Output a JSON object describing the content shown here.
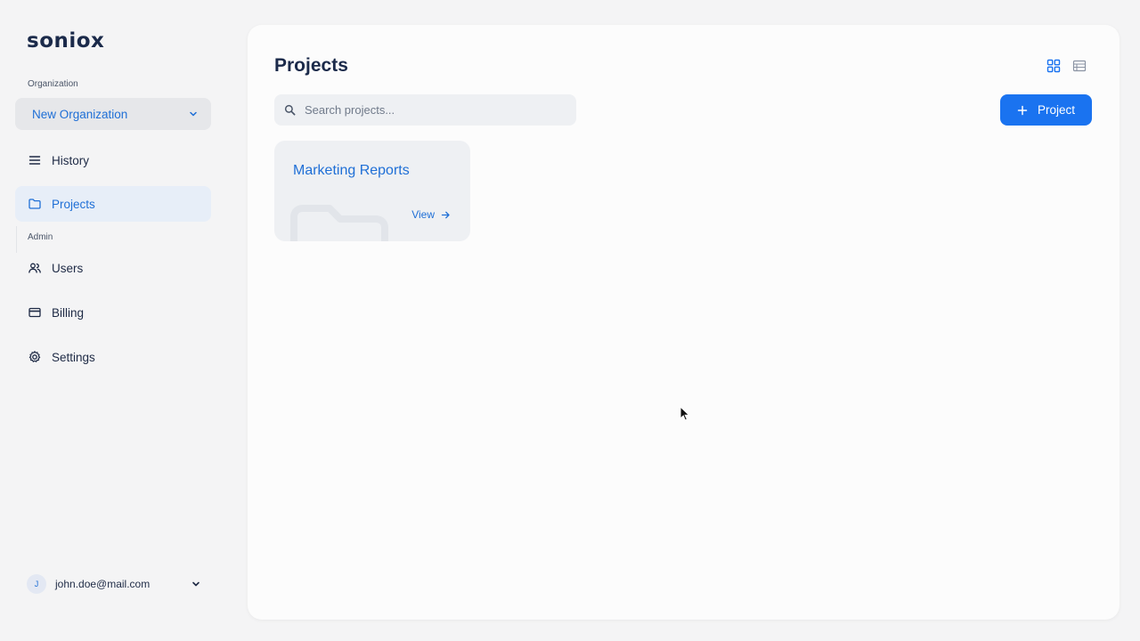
{
  "brand": {
    "logo_text": "soniox"
  },
  "sidebar": {
    "org_label": "Organization",
    "org_selected": "New Organization",
    "nav": [
      {
        "label": "History",
        "icon": "menu-lines-icon"
      },
      {
        "label": "Projects",
        "icon": "folder-icon",
        "active": true
      }
    ],
    "admin_label": "Admin",
    "admin_nav": [
      {
        "label": "Users",
        "icon": "users-icon"
      },
      {
        "label": "Billing",
        "icon": "credit-card-icon"
      },
      {
        "label": "Settings",
        "icon": "gear-icon"
      }
    ],
    "user": {
      "initial": "J",
      "email": "john.doe@mail.com"
    }
  },
  "main": {
    "title": "Projects",
    "search_placeholder": "Search projects...",
    "add_button_label": "Project",
    "projects": [
      {
        "name": "Marketing Reports",
        "action_label": "View"
      }
    ]
  },
  "colors": {
    "accent": "#1a73f0",
    "link": "#1f6fd6",
    "active_bg": "#e7eef8",
    "card_bg": "#eef0f3"
  }
}
